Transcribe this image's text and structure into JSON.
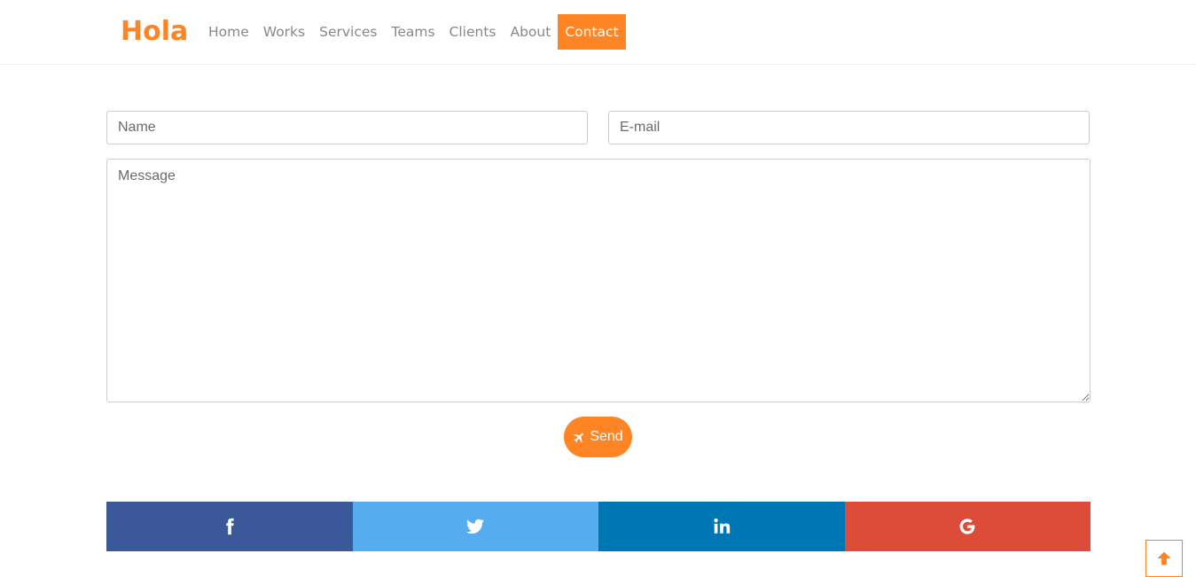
{
  "brand": {
    "name": "Hola"
  },
  "nav": {
    "items": [
      {
        "label": "Home"
      },
      {
        "label": "Works"
      },
      {
        "label": "Services"
      },
      {
        "label": "Teams"
      },
      {
        "label": "Clients"
      },
      {
        "label": "About"
      },
      {
        "label": "Contact",
        "active": true
      }
    ]
  },
  "form": {
    "name_placeholder": "Name",
    "email_placeholder": "E-mail",
    "message_placeholder": "Message",
    "send_label": "Send",
    "send_icon": "plane-icon"
  },
  "social": [
    {
      "icon": "facebook-icon",
      "color": "#3b5998"
    },
    {
      "icon": "twitter-icon",
      "color": "#55acee"
    },
    {
      "icon": "linkedin-icon",
      "color": "#0077b5"
    },
    {
      "icon": "google-icon",
      "color": "#dd4b39"
    }
  ],
  "back_to_top": {
    "icon": "arrow-up-icon"
  },
  "colors": {
    "accent": "#ff8423",
    "nav_text": "#888888",
    "border": "#cccccc"
  }
}
